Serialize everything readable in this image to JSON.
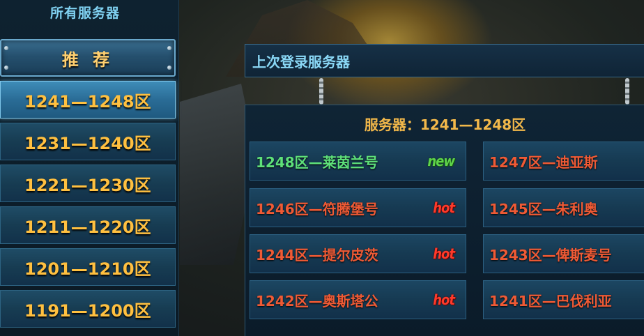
{
  "sidebar": {
    "title": "所有服务器",
    "recommend_label": "推 荐",
    "groups": [
      {
        "label": "1241—1248区",
        "active": true
      },
      {
        "label": "1231—1240区",
        "active": false
      },
      {
        "label": "1221—1230区",
        "active": false
      },
      {
        "label": "1211—1220区",
        "active": false
      },
      {
        "label": "1201—1210区",
        "active": false
      },
      {
        "label": "1191—1200区",
        "active": false
      }
    ]
  },
  "last_login": {
    "title": "上次登录服务器"
  },
  "server_panel": {
    "title": "服务器：1241—1248区",
    "servers": [
      {
        "name": "1248区—莱茵兰号",
        "badge": "new"
      },
      {
        "name": "1247区—迪亚斯",
        "badge": ""
      },
      {
        "name": "1246区—符腾堡号",
        "badge": "hot"
      },
      {
        "name": "1245区—朱利奥",
        "badge": ""
      },
      {
        "name": "1244区—提尔皮茨",
        "badge": "hot"
      },
      {
        "name": "1243区—俾斯麦号",
        "badge": ""
      },
      {
        "name": "1242区—奥斯塔公",
        "badge": "hot"
      },
      {
        "name": "1241区—巴伐利亚",
        "badge": ""
      }
    ]
  },
  "colors": {
    "group_text": "#ffc040",
    "new_green": "#5ee07a",
    "hot_red": "#ef5a35",
    "accent_blue": "#8ad8f6"
  }
}
